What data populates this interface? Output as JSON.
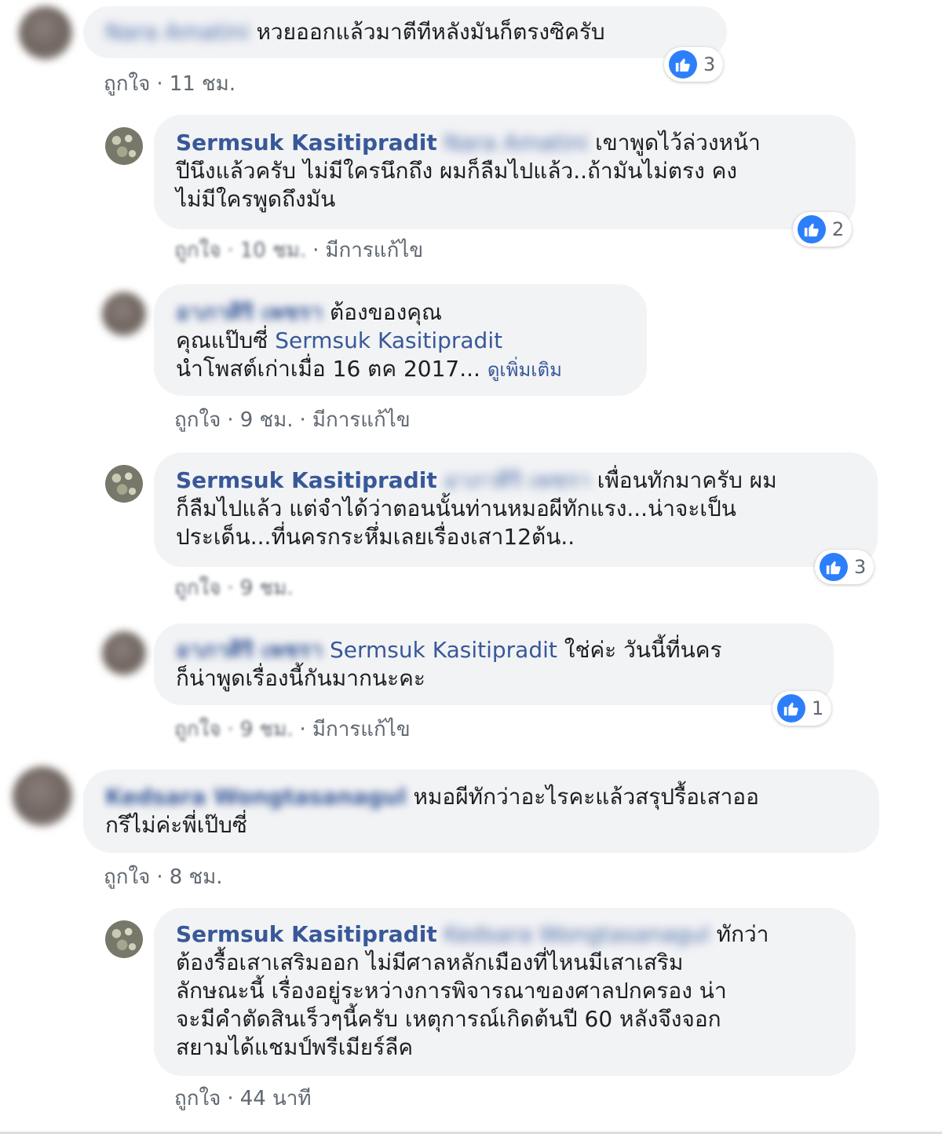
{
  "comments": [
    {
      "author": "Nara Amatini",
      "text": "หวยออกแล้วมาตีทีหลังมันก็ตรงซิครับ",
      "like_label": "ถูกใจ",
      "time": "11 ชม.",
      "reactions": "3"
    },
    {
      "author": "Sermsuk Kasitipradit",
      "mention": "Nara Amatini",
      "text_line1": "เขาพูดไว้ล่วงหน้า",
      "text_line2": "ปีนึงแล้วครับ ไม่มีใครนึกถึง ผมก็ลืมไปแล้ว..ถ้ามันไม่ตรง คง",
      "text_line3": "ไม่มีใครพูดถึงมัน",
      "like_label": "ถูกใจ",
      "time": "10 ชม.",
      "edited": "มีการแก้ไข",
      "reactions": "2"
    },
    {
      "author": "อาภาศิริ เพชรา",
      "text_line1": "ต้องของคุณ",
      "text_line2_prefix": "คุณแป๊บซี่",
      "mention": "Sermsuk Kasitipradit",
      "text_line3": "นำโพสต์เก่าเมื่อ 16 ตค 2017...",
      "see_more": "ดูเพิ่มเติม",
      "like_label": "ถูกใจ",
      "time": "9 ชม.",
      "edited": "มีการแก้ไข"
    },
    {
      "author": "Sermsuk Kasitipradit",
      "mention": "อาภาศิริ เพชรา",
      "text_line1": "เพื่อนทักมาครับ ผม",
      "text_line2": "ก็ลืมไปแล้ว แต่จำได้ว่าตอนนั้นท่านหมอผีทักแรง...น่าจะเป็น",
      "text_line3": "ประเด็น...ที่นครกระหึ่มเลยเรื่องเสา12ต้น..",
      "like_label": "ถูกใจ",
      "time": "9 ชม.",
      "reactions": "3"
    },
    {
      "author": "อาภาศิริ เพชรา",
      "mention": "Sermsuk Kasitipradit",
      "text_line1": "ใช่ค่ะ วันนี้ที่นคร",
      "text_line2": "ก็น่าพูดเรื่องนี้กันมากนะคะ",
      "like_label": "ถูกใจ",
      "time": "9 ชม.",
      "edited": "มีการแก้ไข",
      "reactions": "1"
    },
    {
      "author": "Kedsara Wongtasanagul",
      "text_line1": "หมอผีทักว่าอะไรคะแล้วสรุปรื้อเสาออ",
      "text_line2": "กรึไม่ค่ะพี่เป๊บซี่",
      "like_label": "ถูกใจ",
      "time": "8 ชม."
    },
    {
      "author": "Sermsuk Kasitipradit",
      "mention": "Kedsara Wongtasanagul",
      "text_line1": "ทักว่า",
      "text_line2": "ต้องรื้อเสาเสริมออก ไม่มีศาลหลักเมืองที่ไหนมีเสาเสริม",
      "text_line3": "ลักษณะนี้ เรื่องอยู่ระหว่างการพิจารณาของศาลปกครอง น่า",
      "text_line4": "จะมีคำตัดสินเร็วๆนี้ครับ เหตุการณ์เกิดต้นปี 60 หลังจึงจอก",
      "text_line5": "สยามได้แชมป์พรีเมียร์ลีค",
      "like_label": "ถูกใจ",
      "time": "44 นาที"
    }
  ],
  "colors": {
    "link": "#385898",
    "bubble": "#f2f3f5",
    "like": "#2d7ff9"
  },
  "icons": {
    "reaction": "like-thumb-icon"
  }
}
